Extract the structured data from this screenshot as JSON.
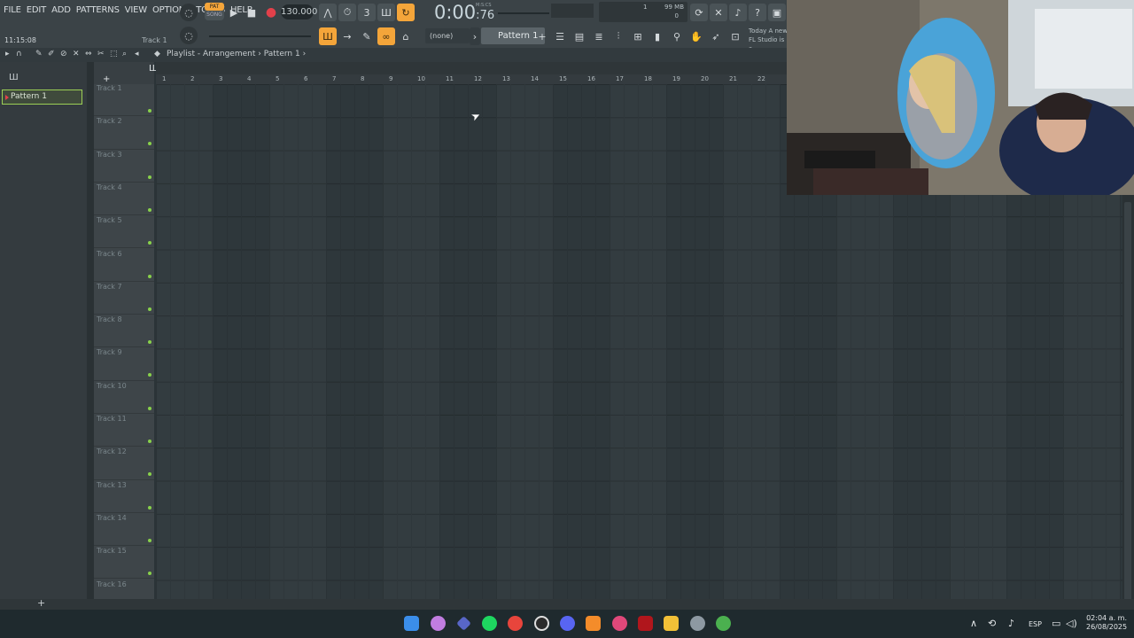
{
  "menu": [
    "FILE",
    "EDIT",
    "ADD",
    "PATTERNS",
    "VIEW",
    "OPTIONS",
    "TOOLS",
    "HELP"
  ],
  "transport": {
    "pat_label": "PAT",
    "song_label": "SONG",
    "tempo": "130.000",
    "time": "0:00",
    "time_frac": "76",
    "time_unit": "M:S:CS"
  },
  "cpu": {
    "memory": "99 MB",
    "polyphony": "1",
    "zero": "0"
  },
  "status": {
    "clock": "11:15:08",
    "hint": "Track 1"
  },
  "pattern_selector": {
    "none": "(none)",
    "current": "Pattern 1"
  },
  "news": {
    "line1_prefix": "Today",
    "line1": "A new",
    "line2": "FL Studio is a"
  },
  "playlist": {
    "breadcrumb": [
      "Playlist - Arrangement",
      "Pattern 1"
    ]
  },
  "picker": {
    "items": [
      "Pattern 1"
    ]
  },
  "tracks": [
    "Track 1",
    "Track 2",
    "Track 3",
    "Track 4",
    "Track 5",
    "Track 6",
    "Track 7",
    "Track 8",
    "Track 9",
    "Track 10",
    "Track 11",
    "Track 12",
    "Track 13",
    "Track 14",
    "Track 15",
    "Track 16"
  ],
  "ruler": [
    "1",
    "2",
    "3",
    "4",
    "5",
    "6",
    "7",
    "8",
    "9",
    "10",
    "11",
    "12",
    "13",
    "14",
    "15",
    "16",
    "17",
    "18",
    "19",
    "20",
    "21",
    "22"
  ],
  "taskbar": {
    "lang": "ESP",
    "time": "02:04 a. m.",
    "date": "26/08/2025"
  },
  "colors": {
    "accent": "#f4a53a",
    "track_led": "#88d14b",
    "pattern_border": "#9ccf55"
  }
}
